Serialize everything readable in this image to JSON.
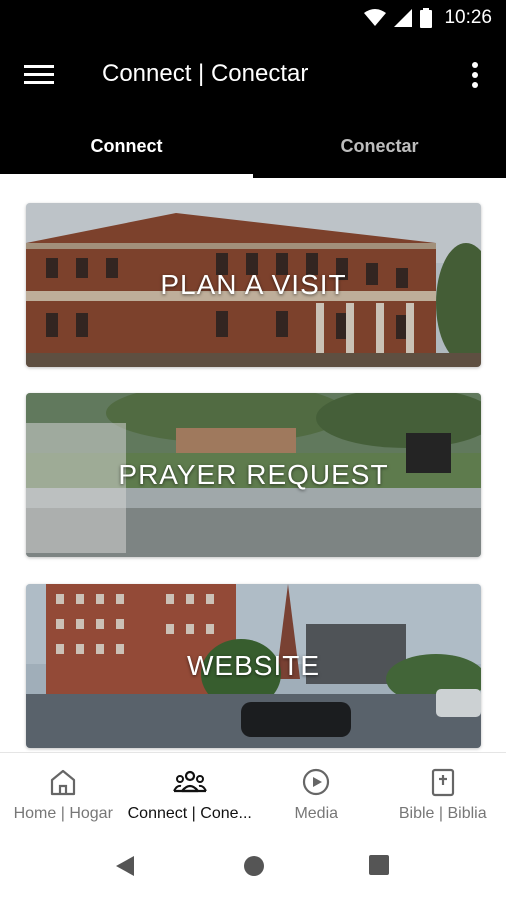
{
  "status_bar": {
    "time": "10:26"
  },
  "app_bar": {
    "title": "Connect | Conectar"
  },
  "tabs": [
    {
      "label": "Connect",
      "active": true
    },
    {
      "label": "Conectar",
      "active": false
    }
  ],
  "cards": [
    {
      "label": "PLAN A VISIT"
    },
    {
      "label": "PRAYER REQUEST"
    },
    {
      "label": "WEBSITE"
    }
  ],
  "bottom_nav": [
    {
      "label": "Home | Hogar",
      "icon": "home-icon",
      "active": false
    },
    {
      "label": "Connect | Cone...",
      "icon": "people-icon",
      "active": true
    },
    {
      "label": "Media",
      "icon": "play-circle-icon",
      "active": false
    },
    {
      "label": "Bible | Biblia",
      "icon": "bible-icon",
      "active": false
    }
  ],
  "colors": {
    "bar_bg": "#000000",
    "active": "#111111",
    "inactive": "#777777"
  }
}
